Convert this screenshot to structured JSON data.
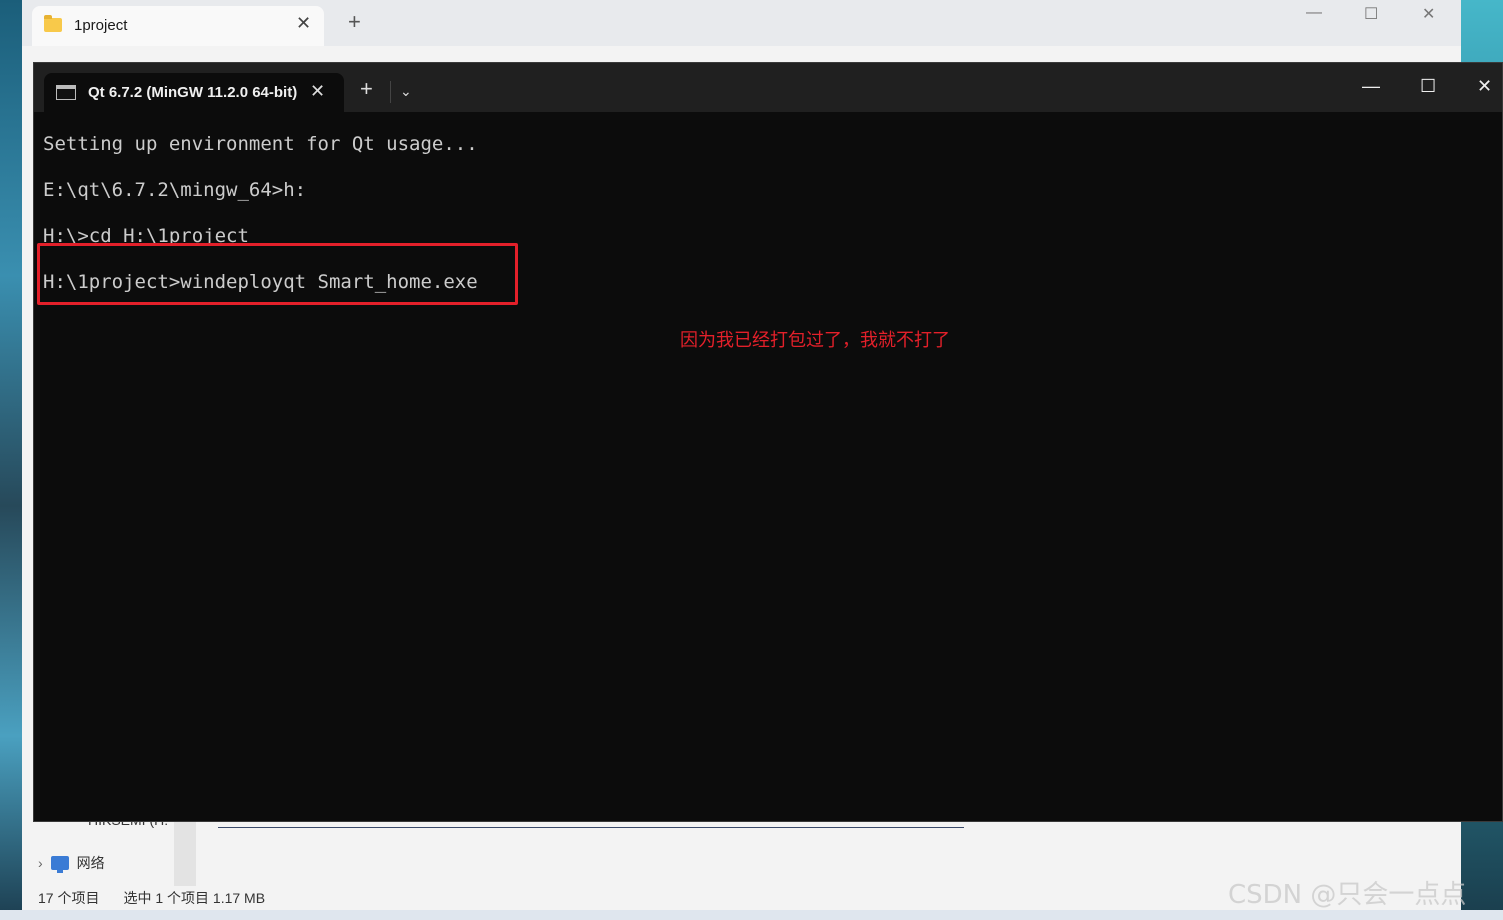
{
  "explorer": {
    "tab_title": "1project",
    "tab_close": "✕",
    "new_tab": "+",
    "minimize": "—",
    "maximize": "☐",
    "close": "✕",
    "nav_drive": "HIKSEMI (H:",
    "nav_network": "网络",
    "status_items": "17 个项目",
    "status_selected": "选中 1 个项目  1.17 MB"
  },
  "terminal": {
    "tab_title": "Qt 6.7.2 (MinGW 11.2.0 64-bit)",
    "tab_close": "✕",
    "new_tab": "+",
    "dropdown": "⌄",
    "minimize": "—",
    "maximize": "☐",
    "close": "✕",
    "lines": [
      "Setting up environment for Qt usage...",
      "E:\\qt\\6.7.2\\mingw_64>h:",
      "H:\\>cd H:\\1project",
      "H:\\1project>windeployqt Smart_home.exe"
    ]
  },
  "annotation": "因为我已经打包过了，我就不打了",
  "watermark": "CSDN @只会一点点",
  "colors": {
    "highlight": "#e3202a",
    "terminal_bg": "#0c0c0c",
    "terminal_text": "#cccccc"
  }
}
